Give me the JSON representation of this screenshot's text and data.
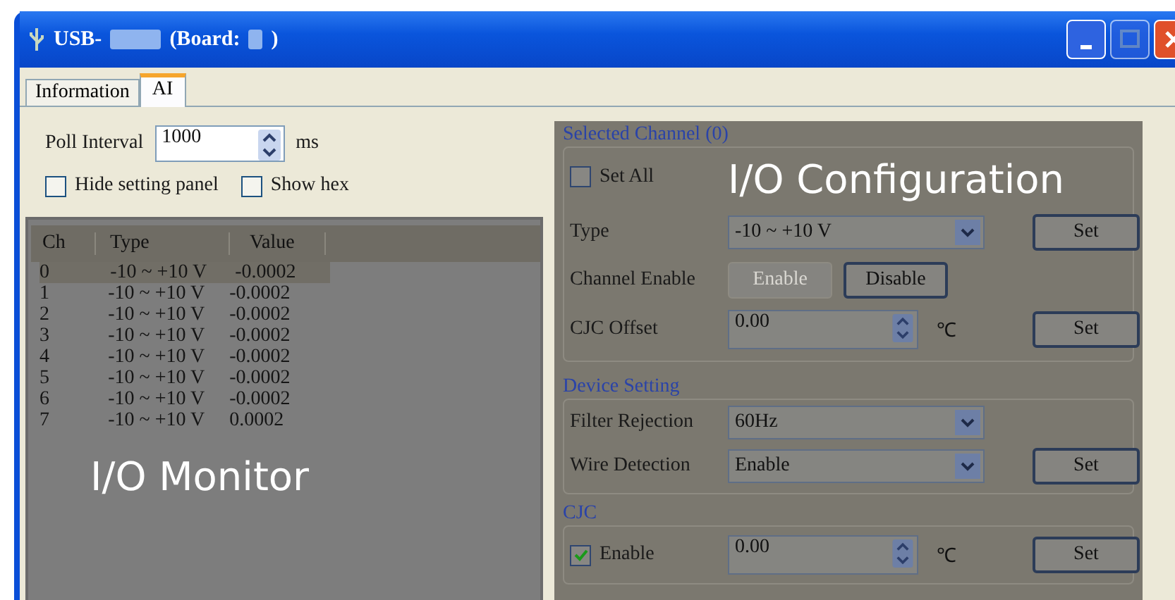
{
  "window": {
    "title_parts": [
      "USB-",
      "(Board:",
      ")"
    ]
  },
  "tabs": [
    {
      "label": "Information",
      "selected": false
    },
    {
      "label": "AI",
      "selected": true
    }
  ],
  "poll": {
    "label": "Poll Interval",
    "value": "1000",
    "unit": "ms"
  },
  "options": [
    {
      "label": "Hide setting panel",
      "checked": false
    },
    {
      "label": "Show hex",
      "checked": false
    }
  ],
  "monitor": {
    "annotation": "I/O Monitor",
    "columns": [
      "Ch",
      "Type",
      "Value"
    ],
    "rows": [
      {
        "cells": [
          "0",
          "-10 ~ +10 V",
          "-0.0002"
        ],
        "selected": true
      },
      {
        "cells": [
          "1",
          "-10 ~ +10 V",
          "-0.0002"
        ],
        "selected": false
      },
      {
        "cells": [
          "2",
          "-10 ~ +10 V",
          "-0.0002"
        ],
        "selected": false
      },
      {
        "cells": [
          "3",
          "-10 ~ +10 V",
          "-0.0002"
        ],
        "selected": false
      },
      {
        "cells": [
          "4",
          "-10 ~ +10 V",
          "-0.0002"
        ],
        "selected": false
      },
      {
        "cells": [
          "5",
          "-10 ~ +10 V",
          "-0.0002"
        ],
        "selected": false
      },
      {
        "cells": [
          "6",
          "-10 ~ +10 V",
          "-0.0002"
        ],
        "selected": false
      },
      {
        "cells": [
          "7",
          "-10 ~ +10 V",
          "0.0002"
        ],
        "selected": false
      }
    ]
  },
  "config": {
    "annotation": "I/O Configuration",
    "selected_channel": {
      "title": "Selected Channel (0)",
      "set_all": {
        "label": "Set All",
        "checked": false
      },
      "type": {
        "label": "Type",
        "value": "-10 ~ +10 V",
        "button": "Set"
      },
      "channel_enable": {
        "label": "Channel Enable",
        "buttons": [
          {
            "label": "Enable",
            "disabled": true
          },
          {
            "label": "Disable",
            "disabled": false
          }
        ]
      },
      "cjc_offset": {
        "label": "CJC Offset",
        "value": "0.00",
        "unit": "℃",
        "button": "Set"
      }
    },
    "device_setting": {
      "title": "Device Setting",
      "rows": [
        {
          "label": "Filter Rejection",
          "value": "60Hz"
        },
        {
          "label": "Wire Detection",
          "value": "Enable"
        }
      ],
      "button": "Set"
    },
    "cjc": {
      "title": "CJC",
      "enable": {
        "label": "Enable",
        "checked": true
      },
      "value": "0.00",
      "unit": "℃",
      "button": "Set"
    }
  }
}
